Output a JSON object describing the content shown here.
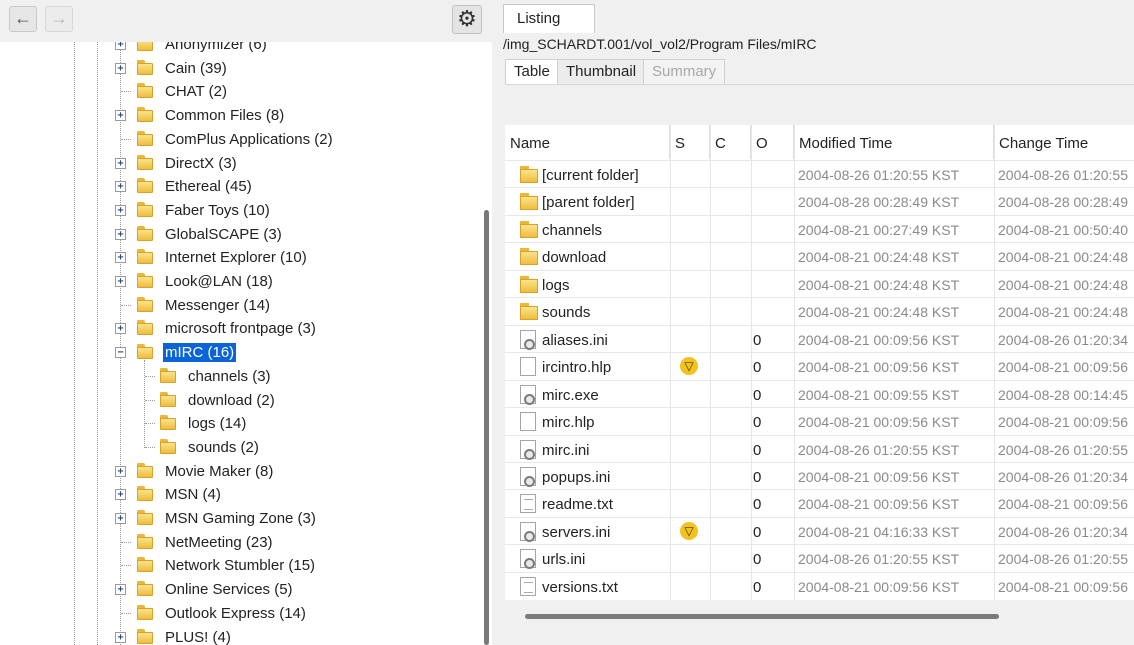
{
  "toolbar": {
    "back_label": "←",
    "forward_label": "→",
    "settings_icon": "⚙"
  },
  "tree": {
    "items": [
      {
        "label": "Anonymizer (6)",
        "expandable": true
      },
      {
        "label": "Cain (39)",
        "expandable": true
      },
      {
        "label": "CHAT (2)",
        "expandable": false
      },
      {
        "label": "Common Files (8)",
        "expandable": true
      },
      {
        "label": "ComPlus Applications (2)",
        "expandable": false
      },
      {
        "label": "DirectX (3)",
        "expandable": true
      },
      {
        "label": "Ethereal (45)",
        "expandable": true
      },
      {
        "label": "Faber Toys (10)",
        "expandable": true
      },
      {
        "label": "GlobalSCAPE (3)",
        "expandable": true
      },
      {
        "label": "Internet Explorer (10)",
        "expandable": true
      },
      {
        "label": "Look@LAN (18)",
        "expandable": true
      },
      {
        "label": "Messenger (14)",
        "expandable": false
      },
      {
        "label": "microsoft frontpage (3)",
        "expandable": true
      },
      {
        "label": "mIRC (16)",
        "expandable": true,
        "expanded": true,
        "selected": true
      },
      {
        "label": "channels (3)",
        "child": true
      },
      {
        "label": "download (2)",
        "child": true
      },
      {
        "label": "logs (14)",
        "child": true
      },
      {
        "label": "sounds (2)",
        "child": true
      },
      {
        "label": "Movie Maker (8)",
        "expandable": true
      },
      {
        "label": "MSN (4)",
        "expandable": true
      },
      {
        "label": "MSN Gaming Zone (3)",
        "expandable": true
      },
      {
        "label": "NetMeeting (23)",
        "expandable": false
      },
      {
        "label": "Network Stumbler (15)",
        "expandable": false
      },
      {
        "label": "Online Services (5)",
        "expandable": true
      },
      {
        "label": "Outlook Express (14)",
        "expandable": false
      },
      {
        "label": "PLUS! (4)",
        "expandable": true
      }
    ]
  },
  "listing": {
    "tab_label": "Listing",
    "path": "/img_SCHARDT.001/vol_vol2/Program Files/mIRC",
    "subtabs": [
      "Table",
      "Thumbnail",
      "Summary"
    ],
    "columns": [
      "Name",
      "S",
      "C",
      "O",
      "Modified Time",
      "Change Time"
    ],
    "rows": [
      {
        "name": "[current folder]",
        "kind": "folder",
        "s": "",
        "o": "",
        "mtime": "2004-08-26 01:20:55 KST",
        "ctime": "2004-08-26 01:20:55"
      },
      {
        "name": "[parent folder]",
        "kind": "folder",
        "s": "",
        "o": "",
        "mtime": "2004-08-28 00:28:49 KST",
        "ctime": "2004-08-28 00:28:49"
      },
      {
        "name": "channels",
        "kind": "folder",
        "s": "",
        "o": "",
        "mtime": "2004-08-21 00:27:49 KST",
        "ctime": "2004-08-21 00:50:40"
      },
      {
        "name": "download",
        "kind": "folder",
        "s": "",
        "o": "",
        "mtime": "2004-08-21 00:24:48 KST",
        "ctime": "2004-08-21 00:24:48"
      },
      {
        "name": "logs",
        "kind": "folder",
        "s": "",
        "o": "",
        "mtime": "2004-08-21 00:24:48 KST",
        "ctime": "2004-08-21 00:24:48"
      },
      {
        "name": "sounds",
        "kind": "folder",
        "s": "",
        "o": "",
        "mtime": "2004-08-21 00:24:48 KST",
        "ctime": "2004-08-21 00:24:48"
      },
      {
        "name": "aliases.ini",
        "kind": "cfg",
        "s": "",
        "o": "0",
        "mtime": "2004-08-21 00:09:56 KST",
        "ctime": "2004-08-26 01:20:34"
      },
      {
        "name": "ircintro.hlp",
        "kind": "file",
        "s": "▽",
        "o": "0",
        "mtime": "2004-08-21 00:09:56 KST",
        "ctime": "2004-08-21 00:09:56"
      },
      {
        "name": "mirc.exe",
        "kind": "cfg",
        "s": "",
        "o": "0",
        "mtime": "2004-08-21 00:09:55 KST",
        "ctime": "2004-08-28 00:14:45"
      },
      {
        "name": "mirc.hlp",
        "kind": "file",
        "s": "",
        "o": "0",
        "mtime": "2004-08-21 00:09:56 KST",
        "ctime": "2004-08-21 00:09:56"
      },
      {
        "name": "mirc.ini",
        "kind": "cfg",
        "s": "",
        "o": "0",
        "mtime": "2004-08-26 01:20:55 KST",
        "ctime": "2004-08-26 01:20:55"
      },
      {
        "name": "popups.ini",
        "kind": "cfg",
        "s": "",
        "o": "0",
        "mtime": "2004-08-21 00:09:56 KST",
        "ctime": "2004-08-26 01:20:34"
      },
      {
        "name": "readme.txt",
        "kind": "txt",
        "s": "",
        "o": "0",
        "mtime": "2004-08-21 00:09:56 KST",
        "ctime": "2004-08-21 00:09:56"
      },
      {
        "name": "servers.ini",
        "kind": "cfg",
        "s": "▽",
        "o": "0",
        "mtime": "2004-08-21 04:16:33 KST",
        "ctime": "2004-08-26 01:20:34"
      },
      {
        "name": "urls.ini",
        "kind": "cfg",
        "s": "",
        "o": "0",
        "mtime": "2004-08-26 01:20:55 KST",
        "ctime": "2004-08-26 01:20:55"
      },
      {
        "name": "versions.txt",
        "kind": "txt",
        "s": "",
        "o": "0",
        "mtime": "2004-08-21 00:09:56 KST",
        "ctime": "2004-08-21 00:09:56"
      }
    ]
  },
  "colors": {
    "selection": "#0a64d8",
    "folder": "#eebd3e",
    "warning": "#f2c221"
  }
}
